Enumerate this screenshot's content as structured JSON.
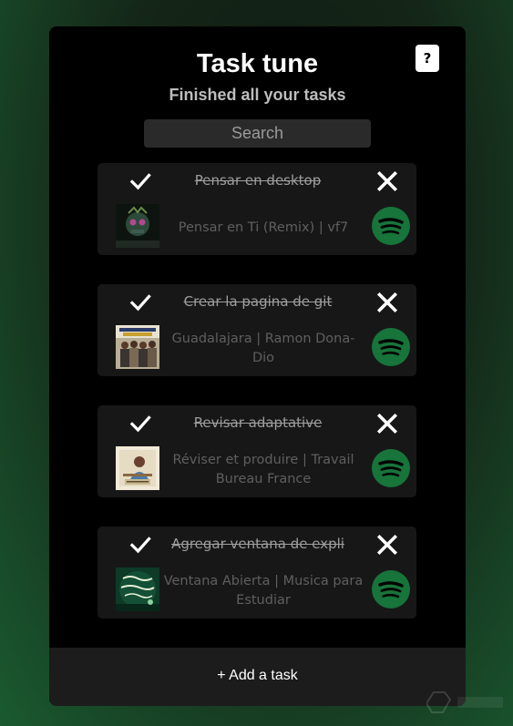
{
  "app": {
    "title": "Task tune",
    "subtitle": "Finished all your tasks",
    "help_label": "?"
  },
  "search": {
    "placeholder": "Search"
  },
  "tasks": [
    {
      "title": "Pensar en desktop",
      "song": "Pensar en Ti (Remix) | vf7",
      "done": true
    },
    {
      "title": "Crear la pagina de git",
      "song": "Guadalajara | Ramon Dona-Dio",
      "done": true
    },
    {
      "title": "Revisar adaptative",
      "song": "Réviser et produire | Travail Bureau France",
      "done": true
    },
    {
      "title": "Agregar ventana de expli",
      "song": "Ventana Abierta | Musica para Estudiar",
      "done": true
    }
  ],
  "icons": {
    "complete": "check-icon",
    "delete": "close-icon",
    "player": "spotify-icon"
  },
  "footer": {
    "add_label": "+ Add a task"
  },
  "colors": {
    "spotify_green": "#1db954",
    "spotify_dark_green": "#17743a",
    "panel_bg": "#000000",
    "card_bg": "#171717"
  }
}
